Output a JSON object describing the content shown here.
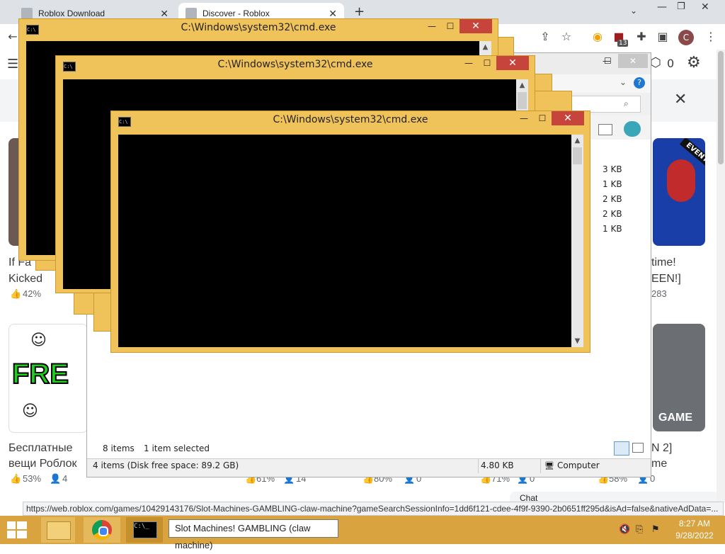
{
  "browser": {
    "tabs": [
      {
        "label": "Roblox Download",
        "active": false
      },
      {
        "label": "Discover - Roblox",
        "active": true
      }
    ],
    "new_tab_label": "+",
    "profile_initial": "C",
    "extension_badge": "13"
  },
  "roblox": {
    "header_robux": "0",
    "close_label": "✕",
    "cards": [
      {
        "title_lines": [
          "If Fa",
          "Kicked"
        ],
        "rating": "42%",
        "players": ""
      },
      {
        "title_lines": [
          "time!",
          "EEN!]"
        ],
        "rating": "",
        "players": "283"
      },
      {
        "title_lines": [
          "Бесплатные",
          "вещи Роблок"
        ],
        "rating": "53%",
        "players": "4"
      },
      {
        "title_lines": [
          "N 2]",
          "me"
        ],
        "rating": "58%",
        "players": "0"
      }
    ],
    "thumb_texts": {
      "free": "FRE",
      "event": "EVENT",
      "game": "GAME"
    },
    "row_stats": [
      {
        "rating": "61%",
        "players": "14"
      },
      {
        "rating": "80%",
        "players": "0"
      },
      {
        "rating": "71%",
        "players": "0"
      }
    ],
    "chat_label": "Chat"
  },
  "explorer": {
    "file_sizes": [
      "3 KB",
      "1 KB",
      "2 KB",
      "2 KB",
      "1 KB"
    ],
    "status_items": "8 items",
    "status_selected": "1 item selected",
    "bottom_left": "4 items (Disk free space: 89.2 GB)",
    "bottom_size": "4.80 KB",
    "bottom_location": "Computer"
  },
  "cmd_windows": [
    {
      "title": "C:\\Windows\\system32\\cmd.exe"
    },
    {
      "title": "C:\\Windows\\system32\\cmd.exe"
    },
    {
      "title": "C:\\Windows\\system32\\cmd.exe"
    }
  ],
  "status_url": "https://web.roblox.com/games/10429143176/Slot-Machines-GAMBLING-claw-machine?gameSearchSessionInfo=1dd6f121-cdee-4f9f-9390-2b0651ff295d&isAd=false&nativeAdData=...",
  "taskbar": {
    "tooltip": "Slot Machines! GAMBLING (claw machine)",
    "time": "8:27 AM",
    "date": "9/28/2022"
  },
  "colors": {
    "cmd_frame": "#f0c35a",
    "taskbar": "#d9a340",
    "close_red": "#c7443c"
  }
}
